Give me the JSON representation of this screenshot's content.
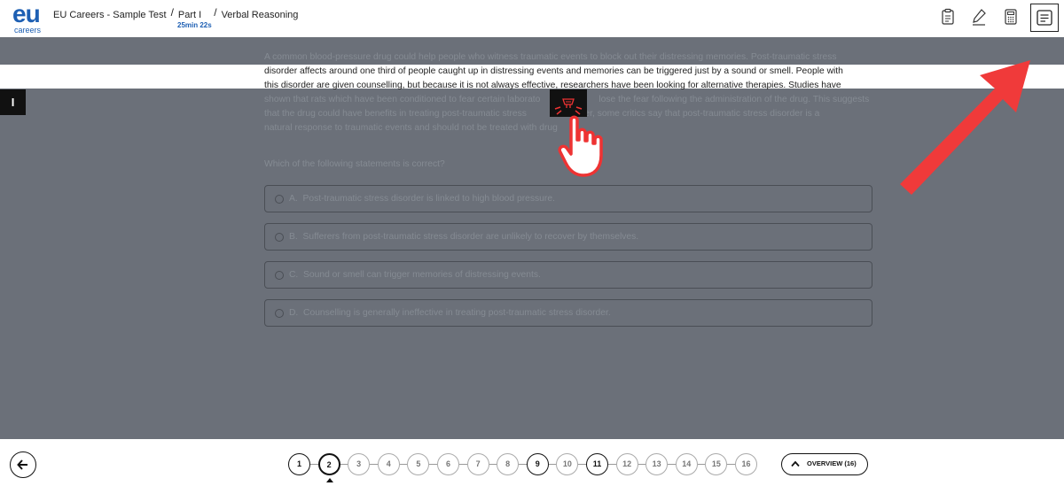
{
  "header": {
    "logo_main": "eu",
    "logo_sub": "careers",
    "breadcrumb": [
      "EU Careers - Sample Test",
      "Part I",
      "Verbal Reasoning"
    ],
    "separator": "/",
    "timer": "25min 22s",
    "tools": [
      "clipboard-icon",
      "pen-icon",
      "calculator-icon",
      "notes-icon"
    ]
  },
  "passage": {
    "line1": "A common blood-pressure drug could help people who witness traumatic events to block out their distressing memories. Post-traumatic stress",
    "line2": "disorder affects around one third of people caught up in distressing events and memories can be triggered just by a sound or smell. People with",
    "line3": "this disorder are given counselling, but because it is not always effective, researchers have been looking for alternative therapies. Studies have",
    "line4a": "shown that rats which have been conditioned to fear certain laborato",
    "line4b": "lose the fear following the administration of the drug. This suggests",
    "line5a": "that the drug could have benefits in treating post-traumatic stress",
    "line5b": "However, some critics say that post-traumatic stress disorder is a",
    "line6": "natural response to traumatic events and should not be treated with drug"
  },
  "question": "Which of the following statements is correct?",
  "options": [
    {
      "letter": "A.",
      "text": "Post-traumatic stress disorder is linked to high blood pressure."
    },
    {
      "letter": "B.",
      "text": "Sufferers from post-traumatic stress disorder are unlikely to recover by themselves."
    },
    {
      "letter": "C.",
      "text": "Sound or smell can trigger memories of distressing events."
    },
    {
      "letter": "D.",
      "text": "Counselling is generally ineffective in treating post-traumatic stress disorder."
    }
  ],
  "side_handle": "I",
  "pager": {
    "pages": [
      "1",
      "2",
      "3",
      "4",
      "5",
      "6",
      "7",
      "8",
      "9",
      "10",
      "11",
      "12",
      "13",
      "14",
      "15",
      "16"
    ],
    "answered": [
      1,
      9,
      11
    ],
    "current": 2
  },
  "overview_label": "OVERVIEW (16)",
  "colors": {
    "brand": "#1d5fb3",
    "overlay": "#6b7079",
    "arrow": "#f03a3a"
  }
}
